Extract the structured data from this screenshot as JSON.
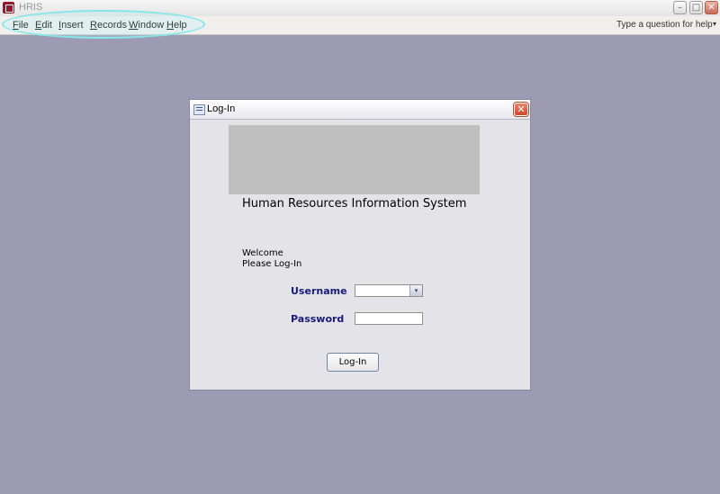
{
  "app": {
    "title": "HRIS",
    "window_controls": {
      "minimize": "–",
      "maximize": "□",
      "close": "✕"
    }
  },
  "menu": {
    "items": [
      {
        "access_key": "F",
        "rest": "ile"
      },
      {
        "access_key": "E",
        "rest": "dit"
      },
      {
        "access_key": "I",
        "rest": "nsert"
      },
      {
        "access_key": "R",
        "rest": "ecords"
      },
      {
        "access_key": "W",
        "rest": "indow"
      },
      {
        "access_key": "H",
        "rest": "elp"
      }
    ],
    "help_box": {
      "placeholder": "Type a question for help",
      "arrow": "▾"
    }
  },
  "dialog": {
    "title": "Log-In",
    "close_glyph": "✕",
    "system_title": "Human Resources Information System",
    "welcome_line1": "Welcome",
    "welcome_line2": "Please Log-In",
    "username_label": "Username",
    "username_value": "",
    "dropdown_glyph": "▾",
    "password_label": "Password",
    "password_value": "",
    "login_button": "Log-In"
  },
  "colors": {
    "workspace": "#9c9bb3",
    "field_label": "#1a1a7a",
    "menu_highlight": "#86e6ea"
  }
}
